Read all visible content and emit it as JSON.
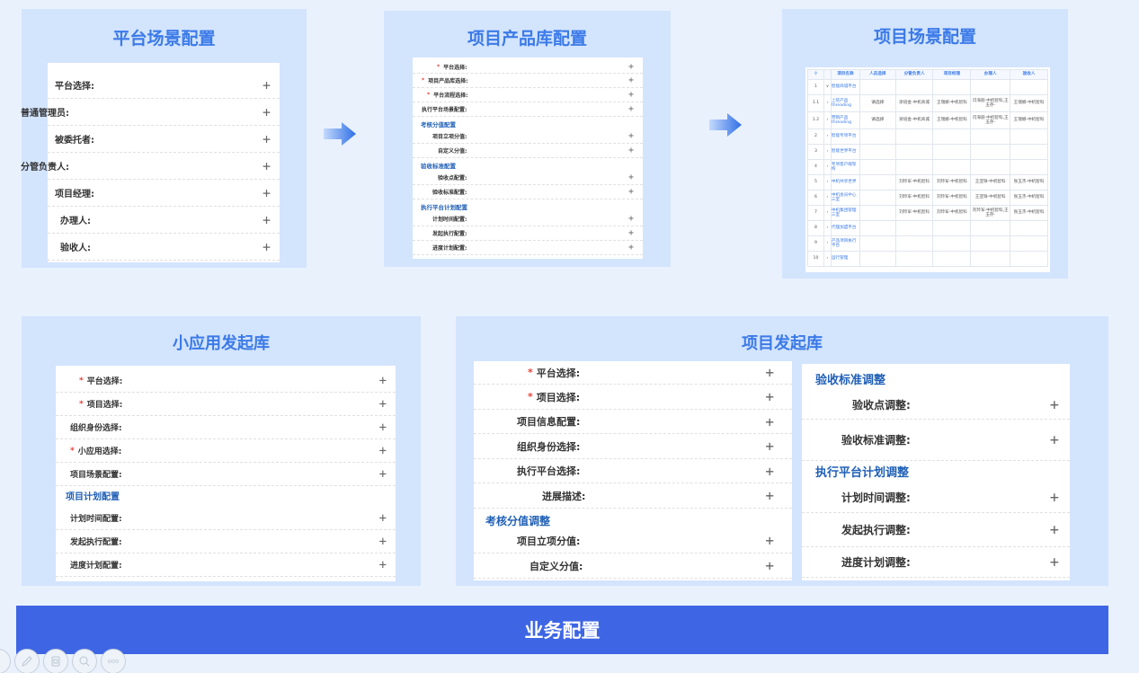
{
  "platform_scene": {
    "title": "平台场景配置",
    "rows": [
      {
        "label": "平台选择:",
        "plus": "+"
      },
      {
        "label": "普通管理员:",
        "plus": "+"
      },
      {
        "label": "被委托者:",
        "plus": "+"
      },
      {
        "label": "分管负责人:",
        "plus": "+"
      },
      {
        "label": "项目经理:",
        "plus": "+"
      },
      {
        "label": "办理人:",
        "plus": "+"
      },
      {
        "label": "验收人:",
        "plus": "+"
      }
    ]
  },
  "product_library": {
    "title": "项目产品库配置",
    "items": [
      {
        "label": "平台选择:",
        "required": true
      },
      {
        "label": "项目产品库选择:",
        "required": true
      },
      {
        "label": "平台流程选择:",
        "required": true
      },
      {
        "label": "执行平台场景配置:",
        "required": false
      },
      {
        "section": "考核分值配置"
      },
      {
        "label": "项目立项分值:",
        "required": false
      },
      {
        "label": "自定义分值:",
        "required": false
      },
      {
        "section": "验收标准配置"
      },
      {
        "label": "验收点配置:",
        "required": false
      },
      {
        "label": "验收标准配置:",
        "required": false
      },
      {
        "section": "执行平台计划配置"
      },
      {
        "label": "计划时间配置:",
        "required": false
      },
      {
        "label": "发起执行配置:",
        "required": false
      },
      {
        "label": "进度计划配置:",
        "required": false
      }
    ]
  },
  "project_scene": {
    "title": "项目场景配置",
    "table": {
      "headers": [
        "项目名称",
        "人员选择",
        "分管负责人",
        "项目经理",
        "办理人",
        "验收人"
      ],
      "rows": [
        {
          "no": "1",
          "name": "智能商城平台",
          "select": "",
          "c1": "",
          "c2": "",
          "c3": "",
          "c4": ""
        },
        {
          "no": "1.1",
          "name": "上装产品threading",
          "select": "请选择",
          "c1": "梁培金-中机商城",
          "c2": "王瑞娜-中机智科",
          "c3": "闫海丽-中机智科,王玉存-",
          "c4": "王瑞娜-中机智科"
        },
        {
          "no": "1.2",
          "name": "营销产品threading",
          "select": "请选择",
          "c1": "梁培金-中机商城",
          "c2": "王瑞娜-中机智科",
          "c3": "闫海丽-中机智科,王玉存-",
          "c4": "王瑞娜-中机智科"
        },
        {
          "no": "2",
          "name": "智能专项平台",
          "select": "",
          "c1": "",
          "c2": "",
          "c3": "",
          "c4": ""
        },
        {
          "no": "3",
          "name": "智能世界平台",
          "select": "",
          "c1": "",
          "c2": "",
          "c3": "",
          "c4": ""
        },
        {
          "no": "4",
          "name": "专项客户端架构",
          "select": "",
          "c1": "",
          "c2": "",
          "c3": "",
          "c4": ""
        },
        {
          "no": "5",
          "name": "中机共享世界",
          "select": "",
          "c1": "刘玲军-中机智科",
          "c2": "刘玲军-中机智科",
          "c3": "王亚铮-中机智科",
          "c4": "张玉杰-中机智科"
        },
        {
          "no": "6",
          "name": "中机会员中心三室",
          "select": "",
          "c1": "刘玲军-中机智科",
          "c2": "刘玲军-中机智科",
          "c3": "王亚铮-中机智科",
          "c4": "张玉杰-中机智科"
        },
        {
          "no": "7",
          "name": "中机集团管理三室",
          "select": "",
          "c1": "刘玲军-中机智科",
          "c2": "刘玲军-中机智科",
          "c3": "刘玲军-中机智科,王玉存-",
          "c4": "张玉杰-中机智科"
        },
        {
          "no": "8",
          "name": "代理加盟平台",
          "select": "",
          "c1": "",
          "c2": "",
          "c3": "",
          "c4": ""
        },
        {
          "no": "9",
          "name": "产品项目执行平台",
          "select": "",
          "c1": "",
          "c2": "",
          "c3": "",
          "c4": ""
        },
        {
          "no": "10",
          "name": "运行管理",
          "select": "",
          "c1": "",
          "c2": "",
          "c3": "",
          "c4": ""
        }
      ]
    }
  },
  "mini_app": {
    "title": "小应用发起库",
    "items": [
      {
        "label": "平台选择:",
        "required": true
      },
      {
        "label": "项目选择:",
        "required": true
      },
      {
        "label": "组织身份选择:",
        "required": false
      },
      {
        "label": "小应用选择:",
        "required": true
      },
      {
        "label": "项目场景配置:",
        "required": false
      },
      {
        "section": "项目计划配置"
      },
      {
        "label": "计划时间配置:",
        "required": false
      },
      {
        "label": "发起执行配置:",
        "required": false
      },
      {
        "label": "进度计划配置:",
        "required": false
      }
    ]
  },
  "project_launch": {
    "title": "项目发起库",
    "left_items": [
      {
        "label": "平台选择:",
        "required": true
      },
      {
        "label": "项目选择:",
        "required": true
      },
      {
        "label": "项目信息配置:",
        "required": false
      },
      {
        "label": "组织身份选择:",
        "required": false
      },
      {
        "label": "执行平台选择:",
        "required": false
      },
      {
        "label": "进展描述:",
        "required": false
      },
      {
        "section": "考核分值调整"
      },
      {
        "label": "项目立项分值:",
        "required": false
      },
      {
        "label": "自定义分值:",
        "required": false
      }
    ],
    "right_items": [
      {
        "section": "验收标准调整"
      },
      {
        "label": "验收点调整:",
        "required": false
      },
      {
        "label": "验收标准调整:",
        "required": false
      },
      {
        "section": "执行平台计划调整"
      },
      {
        "label": "计划时间调整:",
        "required": false
      },
      {
        "label": "发起执行调整:",
        "required": false
      },
      {
        "label": "进度计划调整:",
        "required": false
      }
    ]
  },
  "banner": {
    "label": "业务配置"
  },
  "plus_symbol": "+",
  "required_mark": "*",
  "toolbar": {
    "icons": [
      "edit-icon",
      "copy-icon",
      "zoom-icon",
      "more-icon"
    ],
    "more_label": "ooo"
  },
  "colors": {
    "title": "#3b7ae8",
    "banner": "#3e66e4",
    "panel": "#d3e4fd",
    "background": "#e9f1fd",
    "required": "#e8423b",
    "section": "#1f5fb6"
  }
}
